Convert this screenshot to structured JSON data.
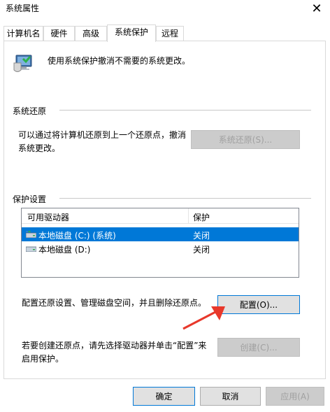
{
  "window": {
    "title": "系统属性"
  },
  "tabs": [
    {
      "label": "计算机名"
    },
    {
      "label": "硬件"
    },
    {
      "label": "高级"
    },
    {
      "label": "系统保护"
    },
    {
      "label": "远程"
    }
  ],
  "intro": {
    "text": "使用系统保护撤消不需要的系统更改。",
    "icon": "system-protection-icon"
  },
  "restore": {
    "group_label": "系统还原",
    "description_line1": "可以通过将计算机还原到上一个还原点，撤消",
    "description_line2": "系统更改。",
    "button_label": "系统还原(S)..."
  },
  "protection": {
    "group_label": "保护设置",
    "columns": [
      "可用驱动器",
      "保护"
    ],
    "drives": [
      {
        "name": "本地磁盘 (C:) (系统)",
        "status": "关闭",
        "selected": true,
        "icon": "system-drive-icon"
      },
      {
        "name": "本地磁盘 (D:)",
        "status": "关闭",
        "selected": false,
        "icon": "drive-icon"
      }
    ],
    "configure_text": "配置还原设置、管理磁盘空间，并且删除还原点。",
    "configure_button": "配置(O)...",
    "create_text_line1": "若要创建还原点，请先选择驱动器并单击“配置”来",
    "create_text_line2": "启用保护。",
    "create_button": "创建(C)..."
  },
  "footer": {
    "ok_label": "确定",
    "cancel_label": "取消",
    "apply_label": "应用(A)"
  },
  "colors": {
    "accent": "#0078d7",
    "arrow": "#e8382b"
  }
}
